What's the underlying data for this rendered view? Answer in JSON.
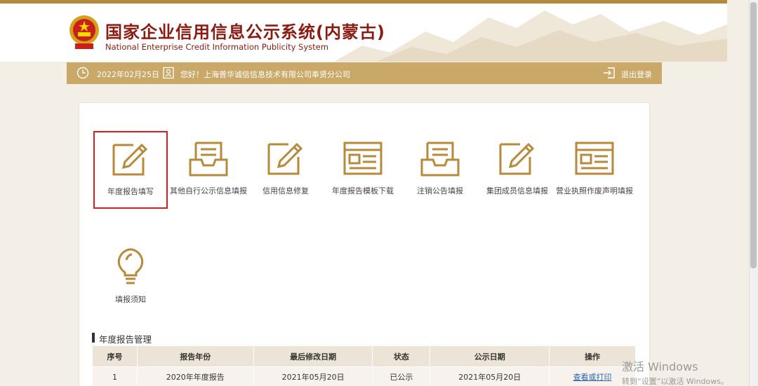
{
  "header": {
    "title_cn": "国家企业信用信息公示系统(内蒙古)",
    "title_en": "National Enterprise Credit Information Publicity System"
  },
  "infobar": {
    "date": "2022年02月25日",
    "greeting": "您好！上海普华诚信信息技术有限公司奉贤分公司",
    "logout": "退出登录"
  },
  "tiles": [
    {
      "label": "年度报告填写",
      "icon": "edit-icon"
    },
    {
      "label": "其他自行公示信息填报",
      "icon": "inbox-icon"
    },
    {
      "label": "信用信息修复",
      "icon": "edit-icon"
    },
    {
      "label": "年度报告模板下载",
      "icon": "template-icon"
    },
    {
      "label": "注销公告填报",
      "icon": "inbox-icon"
    },
    {
      "label": "集团成员信息填报",
      "icon": "edit-icon"
    },
    {
      "label": "营业执照作废声明填报",
      "icon": "template-icon"
    },
    {
      "label": "填报须知",
      "icon": "lightbulb-icon"
    }
  ],
  "section_title": "年度报告管理",
  "table": {
    "headers": [
      "序号",
      "报告年份",
      "最后修改日期",
      "状态",
      "公示日期",
      "操作"
    ],
    "rows": [
      [
        "1",
        "2020年年度报告",
        "2021年05月20日",
        "已公示",
        "2021年05月20日",
        "查看或打印"
      ]
    ]
  },
  "watermark": {
    "line1": "激活 Windows",
    "line2": "转到“设置”以激活 Windows。"
  },
  "colors": {
    "brand_gold": "#c9a868",
    "title_red": "#8b1a10",
    "icon_gold": "#b8893a",
    "selection_red": "#e01b1b",
    "link_blue": "#2a63b5"
  }
}
